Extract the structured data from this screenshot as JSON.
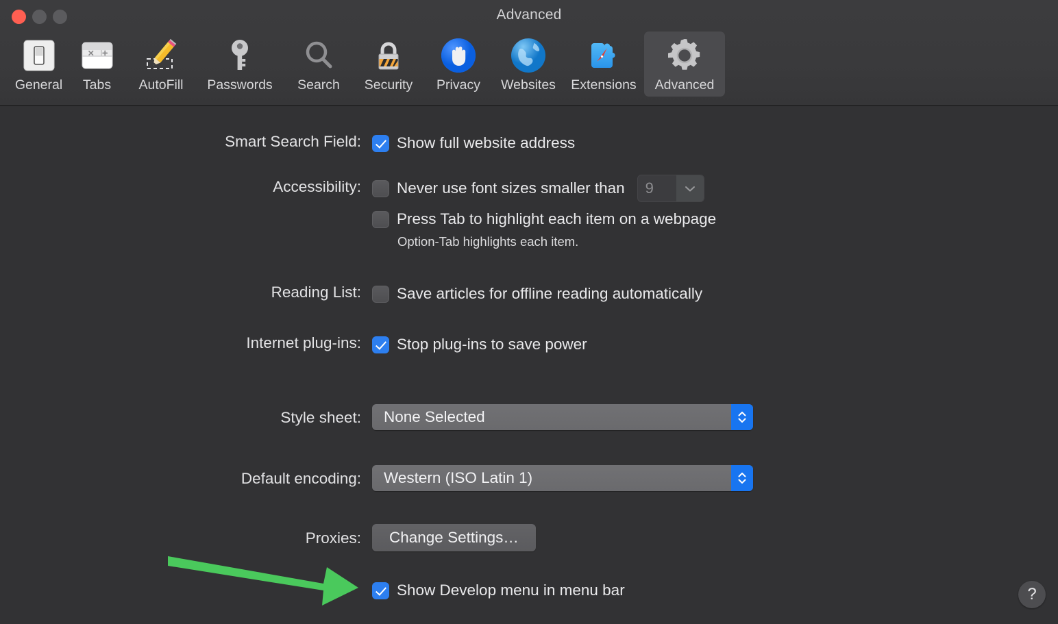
{
  "window": {
    "title": "Advanced",
    "traffic_lights": [
      "close",
      "minimize",
      "zoom"
    ]
  },
  "toolbar": {
    "items": [
      {
        "label": "General",
        "icon": "general-switch-icon",
        "selected": false
      },
      {
        "label": "Tabs",
        "icon": "tabs-icon",
        "selected": false
      },
      {
        "label": "AutoFill",
        "icon": "autofill-pencil-icon",
        "selected": false
      },
      {
        "label": "Passwords",
        "icon": "key-icon",
        "selected": false
      },
      {
        "label": "Search",
        "icon": "magnifier-icon",
        "selected": false
      },
      {
        "label": "Security",
        "icon": "padlock-icon",
        "selected": false
      },
      {
        "label": "Privacy",
        "icon": "hand-icon",
        "selected": false
      },
      {
        "label": "Websites",
        "icon": "globe-icon",
        "selected": false
      },
      {
        "label": "Extensions",
        "icon": "puzzle-compass-icon",
        "selected": false
      },
      {
        "label": "Advanced",
        "icon": "gear-icon",
        "selected": true
      }
    ]
  },
  "settings": {
    "smart_search_field": {
      "label": "Smart Search Field:",
      "checkbox_label": "Show full website address",
      "checked": true
    },
    "accessibility": {
      "label": "Accessibility:",
      "font_size_option": {
        "checkbox_label": "Never use font sizes smaller than",
        "checked": false,
        "value": "9",
        "enabled": false
      },
      "tab_highlight_option": {
        "checkbox_label": "Press Tab to highlight each item on a webpage",
        "checked": false
      },
      "help_text": "Option-Tab highlights each item."
    },
    "reading_list": {
      "label": "Reading List:",
      "checkbox_label": "Save articles for offline reading automatically",
      "checked": false
    },
    "internet_plugins": {
      "label": "Internet plug-ins:",
      "checkbox_label": "Stop plug-ins to save power",
      "checked": true
    },
    "style_sheet": {
      "label": "Style sheet:",
      "value": "None Selected"
    },
    "default_encoding": {
      "label": "Default encoding:",
      "value": "Western (ISO Latin 1)"
    },
    "proxies": {
      "label": "Proxies:",
      "button_label": "Change Settings…"
    },
    "develop_menu": {
      "checkbox_label": "Show Develop menu in menu bar",
      "checked": true
    }
  },
  "help_button": {
    "glyph": "?"
  },
  "annotation": {
    "type": "arrow",
    "color": "#4ac95c",
    "points_to": "develop-menu-checkbox"
  },
  "colors": {
    "accent_blue": "#2d7ff0",
    "popup_arrow_blue": "#1875f0",
    "toolbar_bg": "#3a3a3c",
    "content_bg": "#323234",
    "annotation_green": "#4ac95c",
    "close_red": "#ff5f52"
  }
}
